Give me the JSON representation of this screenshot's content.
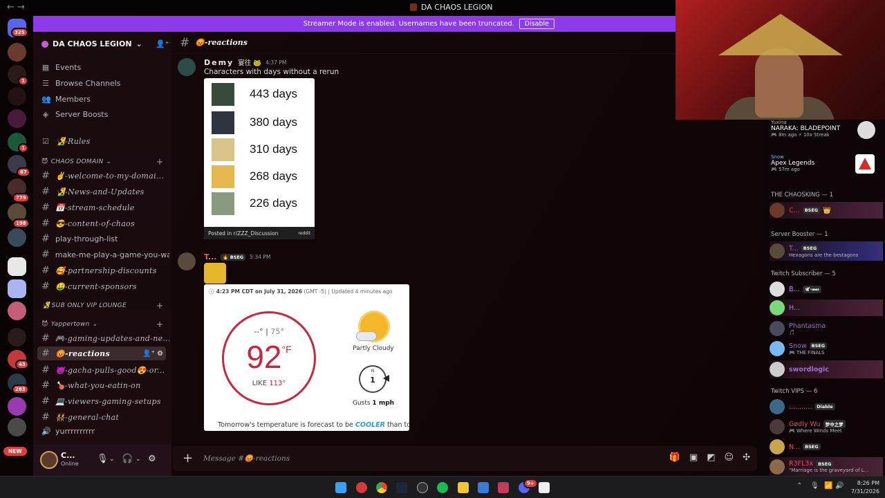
{
  "window": {
    "title": "DA CHAOS LEGION",
    "nav_arrows": "← →"
  },
  "streamer_bar": {
    "text": "Streamer Mode is enabled. Usernames have been truncated.",
    "button": "Disable"
  },
  "rail": {
    "badges": [
      "325",
      "1",
      "1",
      "1",
      "67",
      "779",
      "198",
      "43",
      "283"
    ],
    "new_label": "NEW"
  },
  "server": {
    "name": "DA CHAOS LEGION",
    "menu": [
      {
        "label": "Events",
        "icon": "calendar-icon"
      },
      {
        "label": "Browse Channels",
        "icon": "browse-icon"
      },
      {
        "label": "Members",
        "icon": "members-icon"
      },
      {
        "label": "Server Boosts",
        "icon": "boost-icon"
      }
    ],
    "rules": "🧏‍♂️-Rules",
    "categories": {
      "chaos": "CHAOS DOMAIN",
      "vip": "🧏‍♂️ SUB ONLY VIP LOUNGE",
      "yapper": "Yappertown"
    },
    "chaos_channels": [
      "✌️-welcome-to-my-domai...",
      "🧏‍♂️-News-and-Updates",
      "📅-stream-schedule",
      "😎-content-of-chaos",
      "play-through-list",
      "make-me-play-a-game-you-wa...",
      "🥰-partnership-discounts",
      "🤑-current-sponsors"
    ],
    "yapper_channels": [
      "🎮-gaming-updates-and-ne...",
      "😡-reactions",
      "👿-gacha-pulls-good😍-or...",
      "🍗-what-you-eatin-on",
      "💻-viewers-gaming-setups",
      "👯-general-chat",
      "yurrrrrrrrrr"
    ]
  },
  "user": {
    "name": "C...",
    "status": "Online"
  },
  "channel": {
    "name": "😡-reactions",
    "composer_placeholder": "Message #😡-reactions"
  },
  "messages": [
    {
      "author": "Demy",
      "badge": "宴往 🐸",
      "time": "4:37 PM",
      "text": "Characters with days without a rerun",
      "embed": {
        "rows": [
          "443 days",
          "380 days",
          "310 days",
          "268 days",
          "226 days"
        ],
        "footer": "Posted in r/ZZZ_Discussion",
        "footer_brand": "reddit"
      }
    },
    {
      "author": "T...",
      "tag": "BSEG",
      "time": "5:34 PM",
      "weather": {
        "header_time": "4:23 PM CDT on July 31, 2026",
        "header_tz": "(GMT -5)",
        "header_updated": "Updated 4 minutes ago",
        "low": "--°",
        "high": "75°",
        "temp": "92",
        "unit": "°F",
        "feels_like_label": "LIKE",
        "feels_like": "113°",
        "condition": "Partly Cloudy",
        "wind_dir": "N",
        "wind_speed": "1",
        "gusts_label": "Gusts",
        "gusts": "1 mph",
        "tomorrow_pre": "Tomorrow's temperature is forecast to be",
        "tomorrow_word": "COOLER",
        "tomorrow_post": "than today."
      }
    }
  ],
  "members_panel": {
    "activities": [
      {
        "user": "Yuxina",
        "game": "NARAKA: BLADEPOINT",
        "time": "8m ago",
        "streak": "10x Streak"
      },
      {
        "user": "Snow",
        "game": "Apex Legends",
        "time": "57m ago"
      }
    ],
    "groups": [
      {
        "header": "THE CHAOSKING — 1",
        "members": [
          {
            "name": "C...",
            "tag": "BSEG",
            "extra": "👑",
            "color": "#e03b3b"
          }
        ]
      },
      {
        "header": "Server Booster — 1",
        "members": [
          {
            "name": "T...",
            "tag": "BSEG",
            "sub": "Hexagons are the bestagons",
            "color": "#f05a5a"
          }
        ]
      },
      {
        "header": "Twitch Subscriber — 5",
        "members": [
          {
            "name": "B...",
            "tag": "🕊️-𝓌𝒶𝓈",
            "color": "#c77dff"
          },
          {
            "name": "H...",
            "color": "#b07ad8"
          },
          {
            "name": "Phantasma",
            "sub": "🎵",
            "color": "#9b6fd6"
          },
          {
            "name": "Snow",
            "tag": "BSEG",
            "sub": "THE FINALS",
            "color": "#9b6fd6"
          },
          {
            "name": "swordlogic",
            "color": "#9b6fd6"
          }
        ]
      },
      {
        "header": "Twitch VIPS — 6",
        "members": [
          {
            "name": "...........",
            "tag": "Diable",
            "color": "#e04a6a"
          },
          {
            "name": "Gødly Wu",
            "tag": "梦中之梦",
            "sub": "Where Winds Meet",
            "color": "#e04a6a"
          },
          {
            "name": "N...",
            "tag": "BSEG",
            "color": "#e04a6a"
          },
          {
            "name": "R3FL3x",
            "tag": "BSEG",
            "sub": "\"Marriage is the graveyard of L...",
            "color": "#e04a6a"
          }
        ]
      }
    ]
  },
  "taskbar": {
    "time": "8:26 PM",
    "date": "7/31/2026",
    "badge": "9+"
  },
  "colors": {
    "accent": "#8d3aec",
    "weather_red": "#c6283e",
    "cooler_blue": "#2b9cd6",
    "badge_red": "#e23d3d"
  }
}
